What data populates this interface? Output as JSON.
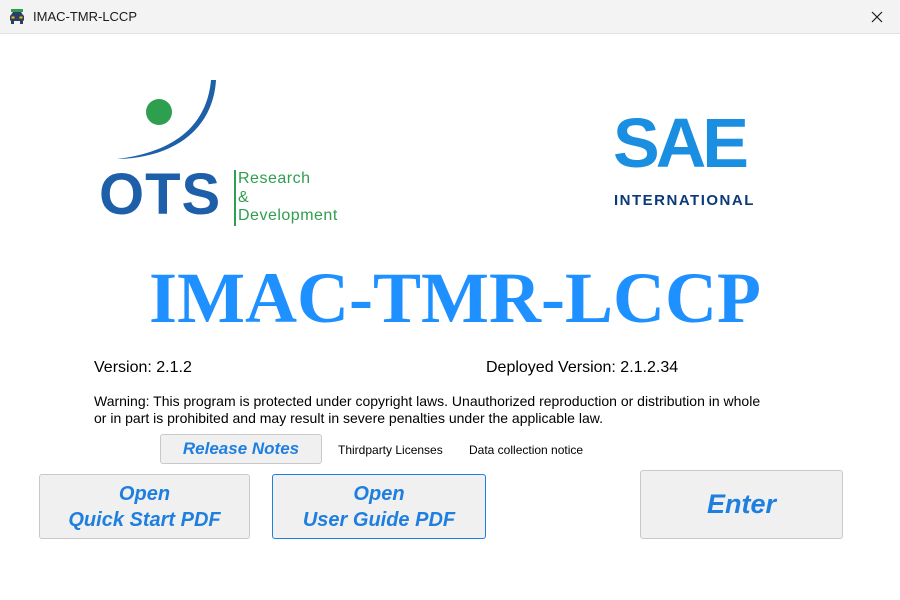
{
  "window": {
    "title": "IMAC-TMR-LCCP",
    "app_icon": "car-icon",
    "close_icon": "close-icon"
  },
  "logos": {
    "ots": {
      "letters": "OTS",
      "line1": "Research",
      "line2": "&",
      "line3": "Development",
      "colors": {
        "blue": "#1d5fa8",
        "green": "#2e9e4f"
      }
    },
    "sae": {
      "letters": "SAE",
      "subtitle": "INTERNATIONAL",
      "colors": {
        "light": "#1a8ee0",
        "dark": "#0b3a78"
      }
    }
  },
  "main": {
    "app_title": "IMAC-TMR-LCCP",
    "version": "Version: 2.1.2",
    "deployed_version": "Deployed Version: 2.1.2.34",
    "warning": "Warning: This program is protected under copyright laws. Unauthorized reproduction or distribution in whole or in part is prohibited and may result in severe penalties under the applicable law."
  },
  "buttons": {
    "release_notes": "Release Notes",
    "quick_start_line1": "Open",
    "quick_start_line2": "Quick Start PDF",
    "user_guide_line1": "Open",
    "user_guide_line2": "User Guide PDF",
    "enter": "Enter"
  },
  "links": {
    "thirdparty": "Thirdparty Licenses",
    "data_collection": "Data collection notice"
  },
  "colors": {
    "accent": "#1e90ff",
    "button_text": "#1e7fe0"
  }
}
